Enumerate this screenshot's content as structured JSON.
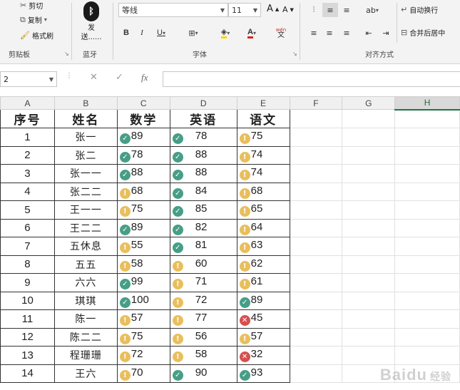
{
  "ribbon": {
    "clipboard": {
      "cut": "剪切",
      "copy": "复制",
      "format_painter": "格式刷",
      "group_label": "剪贴板"
    },
    "bluetooth": {
      "label_top": "发",
      "label_bottom": "送......",
      "group_label": "蓝牙"
    },
    "font": {
      "font_name": "等线",
      "font_size": "11",
      "grow": "A",
      "shrink": "A",
      "bold": "B",
      "italic": "I",
      "underline": "U",
      "font_color_letter": "A",
      "wen": "wén",
      "wen_char": "文",
      "group_label": "字体"
    },
    "alignment": {
      "wrap_text": "自动换行",
      "merge_center": "合并后居中",
      "group_label": "对齐方式"
    }
  },
  "formula_bar": {
    "name_box": "2",
    "fx": "fx"
  },
  "columns": [
    "A",
    "B",
    "C",
    "D",
    "E",
    "F",
    "G",
    "H"
  ],
  "selected_column": "H",
  "headers": [
    "序号",
    "姓名",
    "数学",
    "英语",
    "语文"
  ],
  "rows": [
    {
      "id": "1",
      "name": "张一",
      "math": {
        "v": "89",
        "icon": "check"
      },
      "eng": {
        "v": "78",
        "icon": "check"
      },
      "chn": {
        "v": "75",
        "icon": "warn"
      }
    },
    {
      "id": "2",
      "name": "张二",
      "math": {
        "v": "78",
        "icon": "check"
      },
      "eng": {
        "v": "88",
        "icon": "check"
      },
      "chn": {
        "v": "74",
        "icon": "warn"
      }
    },
    {
      "id": "3",
      "name": "张一一",
      "math": {
        "v": "88",
        "icon": "check"
      },
      "eng": {
        "v": "88",
        "icon": "check"
      },
      "chn": {
        "v": "74",
        "icon": "warn"
      }
    },
    {
      "id": "4",
      "name": "张二二",
      "math": {
        "v": "68",
        "icon": "warn"
      },
      "eng": {
        "v": "84",
        "icon": "check"
      },
      "chn": {
        "v": "68",
        "icon": "warn"
      }
    },
    {
      "id": "5",
      "name": "王一一",
      "math": {
        "v": "75",
        "icon": "warn"
      },
      "eng": {
        "v": "85",
        "icon": "check"
      },
      "chn": {
        "v": "65",
        "icon": "warn"
      }
    },
    {
      "id": "6",
      "name": "王二二",
      "math": {
        "v": "89",
        "icon": "check"
      },
      "eng": {
        "v": "82",
        "icon": "check"
      },
      "chn": {
        "v": "64",
        "icon": "warn"
      }
    },
    {
      "id": "7",
      "name": "五休息",
      "math": {
        "v": "55",
        "icon": "warn"
      },
      "eng": {
        "v": "81",
        "icon": "check"
      },
      "chn": {
        "v": "63",
        "icon": "warn"
      }
    },
    {
      "id": "8",
      "name": "五五",
      "math": {
        "v": "58",
        "icon": "warn"
      },
      "eng": {
        "v": "60",
        "icon": "warn"
      },
      "chn": {
        "v": "62",
        "icon": "warn"
      }
    },
    {
      "id": "9",
      "name": "六六",
      "math": {
        "v": "99",
        "icon": "check"
      },
      "eng": {
        "v": "71",
        "icon": "warn"
      },
      "chn": {
        "v": "61",
        "icon": "warn"
      }
    },
    {
      "id": "10",
      "name": "琪琪",
      "math": {
        "v": "100",
        "icon": "check"
      },
      "eng": {
        "v": "72",
        "icon": "warn"
      },
      "chn": {
        "v": "89",
        "icon": "check"
      }
    },
    {
      "id": "11",
      "name": "陈一",
      "math": {
        "v": "57",
        "icon": "warn"
      },
      "eng": {
        "v": "77",
        "icon": "warn"
      },
      "chn": {
        "v": "45",
        "icon": "cross"
      }
    },
    {
      "id": "12",
      "name": "陈二二",
      "math": {
        "v": "75",
        "icon": "warn"
      },
      "eng": {
        "v": "56",
        "icon": "warn"
      },
      "chn": {
        "v": "57",
        "icon": "warn"
      }
    },
    {
      "id": "13",
      "name": "程珊珊",
      "math": {
        "v": "72",
        "icon": "warn"
      },
      "eng": {
        "v": "58",
        "icon": "warn"
      },
      "chn": {
        "v": "32",
        "icon": "cross"
      }
    },
    {
      "id": "14",
      "name": "王六",
      "math": {
        "v": "70",
        "icon": "warn"
      },
      "eng": {
        "v": "90",
        "icon": "check"
      },
      "chn": {
        "v": "93",
        "icon": "check"
      }
    }
  ],
  "icon_colors": {
    "check": "#479e86",
    "warn": "#e9bf5c",
    "cross": "#d64f4f"
  },
  "watermark": {
    "brand": "Baidu",
    "suffix": "经验"
  }
}
